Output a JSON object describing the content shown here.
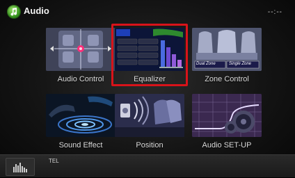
{
  "header": {
    "title": "Audio",
    "clock": "--:--"
  },
  "tiles": [
    {
      "label": "Audio Control"
    },
    {
      "label": "Equalizer"
    },
    {
      "label": "Zone Control",
      "tags": [
        "Dual Zone",
        "Single Zone"
      ]
    },
    {
      "label": "Sound Effect"
    },
    {
      "label": "Position"
    },
    {
      "label": "Audio SET-UP"
    }
  ],
  "footer": {
    "tel_label": "TEL"
  },
  "colors": {
    "accent": "#3c9a22",
    "highlight": "#d8131a",
    "eq_blue": "#1d3fb8"
  }
}
